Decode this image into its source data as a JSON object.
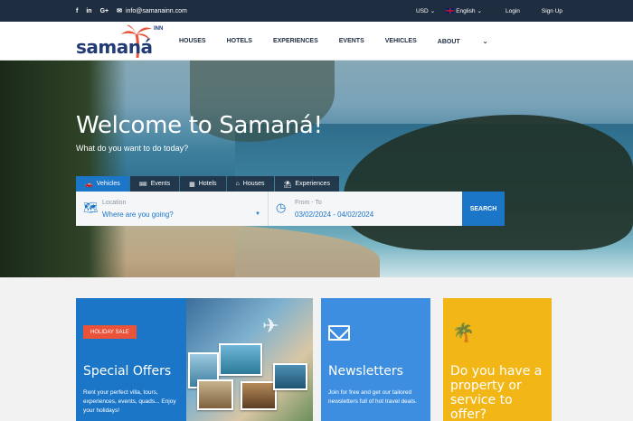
{
  "topbar": {
    "social": [
      "f",
      "in",
      "G+"
    ],
    "email": "info@samanainn.com",
    "currency": "USD",
    "language": "English",
    "login": "Login",
    "signup": "Sign Up"
  },
  "nav": {
    "logo_text": "samaná",
    "logo_inn": "INN",
    "links": [
      "HOUSES",
      "HOTELS",
      "EXPERIENCES",
      "EVENTS",
      "VEHICLES",
      "ABOUT"
    ]
  },
  "hero": {
    "title": "Welcome to Samaná!",
    "subtitle": "What do you want to do today?",
    "tabs": [
      "Vehicles",
      "Events",
      "Hotels",
      "Houses",
      "Experiences"
    ],
    "location_label": "Location",
    "location_value": "Where are you going?",
    "date_label": "From - To",
    "date_value": "03/02/2024 - 04/02/2024",
    "search_button": "SEARCH"
  },
  "cards": {
    "offers": {
      "badge": "HOLIDAY SALE",
      "title": "Special Offers",
      "text": "Rent your perfect villa, tours, experiences, events, quads... Enjoy your holidays!"
    },
    "newsletter": {
      "title": "Newsletters",
      "text": "Join for free and get our tailored newsletters full of hot travel deals."
    },
    "property": {
      "title": "Do you have a property or service to offer?"
    }
  },
  "colors": {
    "topbar": "#1f2d40",
    "primary": "#1b76c8",
    "badge": "#e8533a",
    "yellow": "#f2b716"
  }
}
